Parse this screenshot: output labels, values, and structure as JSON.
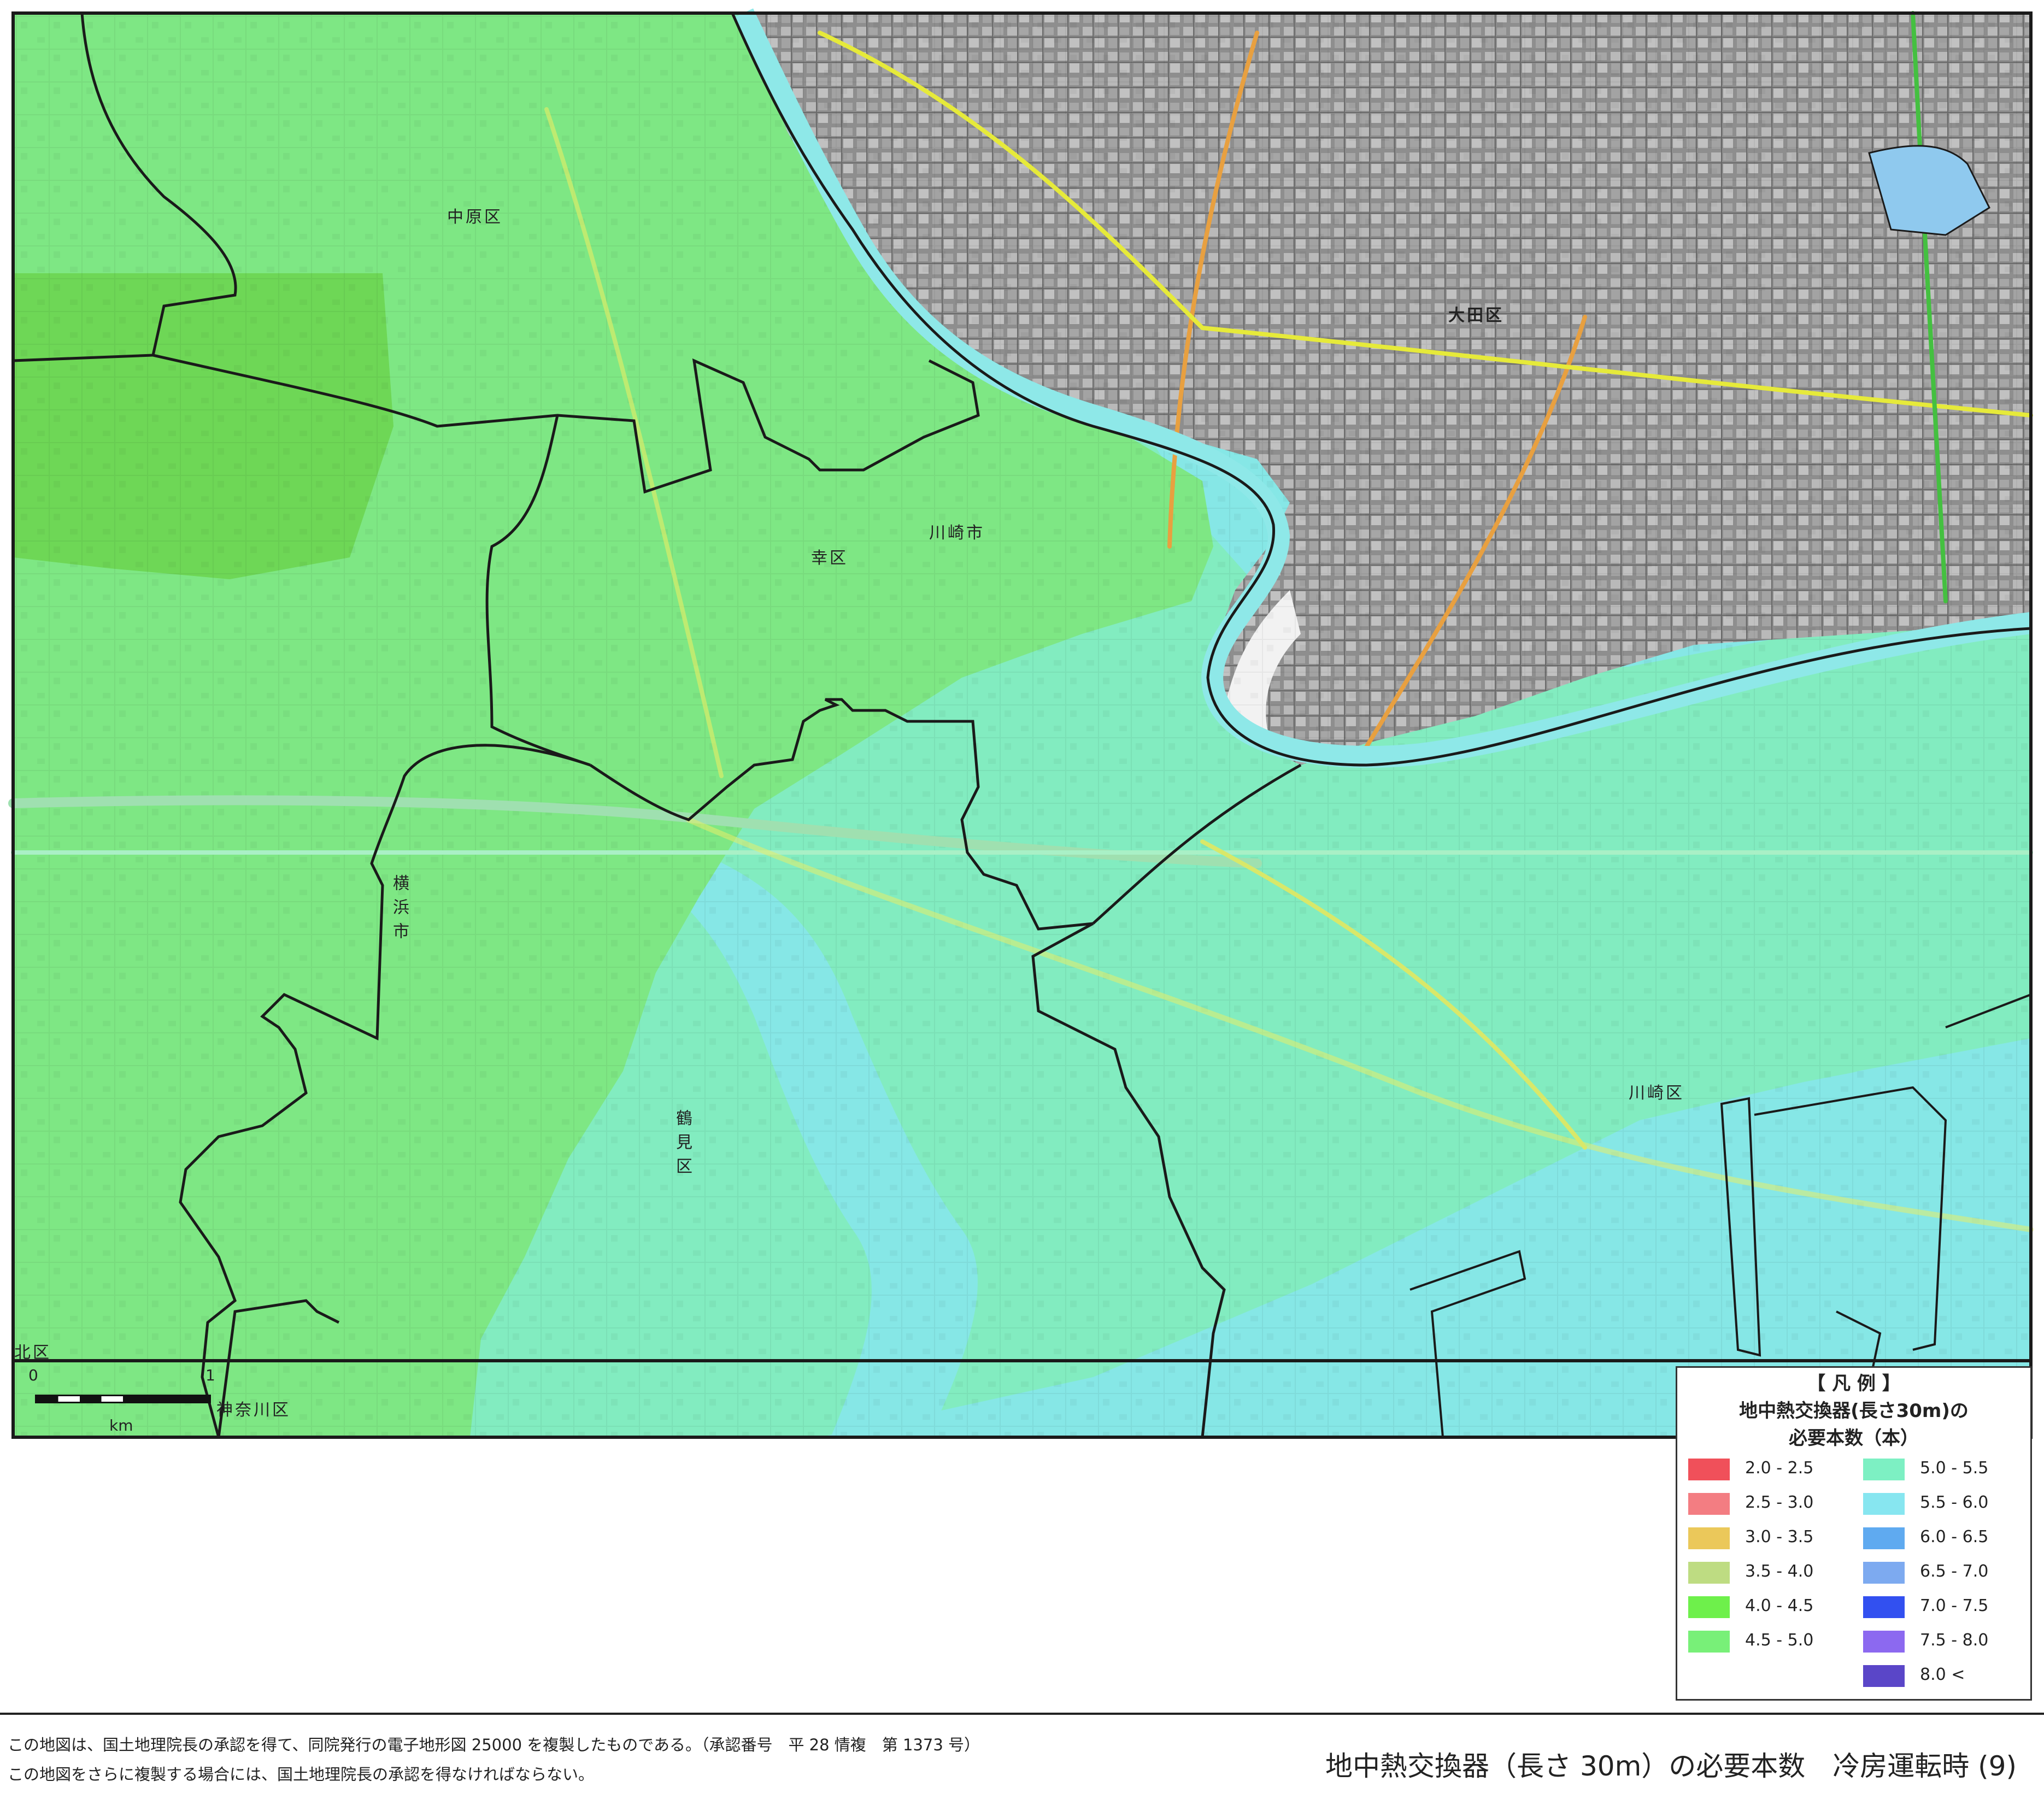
{
  "map": {
    "colors": {
      "band_40_45": "#6ed756",
      "band_45_50": "#7ee784",
      "band_50_55": "#82ecc0",
      "band_55_60": "#86e7e6",
      "boundary": "#1a1a1a"
    },
    "places": {
      "nakahara": "中原区",
      "saiwai": "幸区",
      "kawasaki_city": "川崎市",
      "ota": "大田区",
      "yokohama_city": "横浜市",
      "tsurumi": "鶴見区",
      "kawasaki_ward": "川崎区",
      "kohoku": "北区",
      "kanagawa": "神奈川区"
    },
    "scale": {
      "zero": "0",
      "one": "1",
      "unit": "km"
    }
  },
  "legend": {
    "heading": "【 凡 例 】",
    "subtitle1": "地中熱交換器(長さ30m)の",
    "subtitle2": "必要本数（本）",
    "items": [
      {
        "label": "2.0 - 2.5",
        "color": "#f0505a"
      },
      {
        "label": "2.5 - 3.0",
        "color": "#f37d82"
      },
      {
        "label": "3.0 - 3.5",
        "color": "#ebc85a"
      },
      {
        "label": "3.5 - 4.0",
        "color": "#bedc82"
      },
      {
        "label": "4.0 - 4.5",
        "color": "#6ef04b"
      },
      {
        "label": "4.5 - 5.0",
        "color": "#78f078"
      },
      {
        "label": "5.0 - 5.5",
        "color": "#7df0c3"
      },
      {
        "label": "5.5 - 6.0",
        "color": "#87e6f0"
      },
      {
        "label": "6.0 - 6.5",
        "color": "#5faaf0"
      },
      {
        "label": "6.5 - 7.0",
        "color": "#7daaf0"
      },
      {
        "label": "7.0 - 7.5",
        "color": "#3250f0"
      },
      {
        "label": "7.5 - 8.0",
        "color": "#8c69f0"
      },
      {
        "label": "8.0 <",
        "color": "#5a46c8"
      }
    ]
  },
  "footer": {
    "note1": "この地図は、国土地理院長の承認を得て、同院発行の電子地形図 25000 を複製したものである。（承認番号　平 28 情複　第 1373 号）",
    "note2": "この地図をさらに複製する場合には、国土地理院長の承認を得なければならない。",
    "title": "地中熱交換器（長さ 30m）の必要本数　冷房運転時 (9)"
  }
}
